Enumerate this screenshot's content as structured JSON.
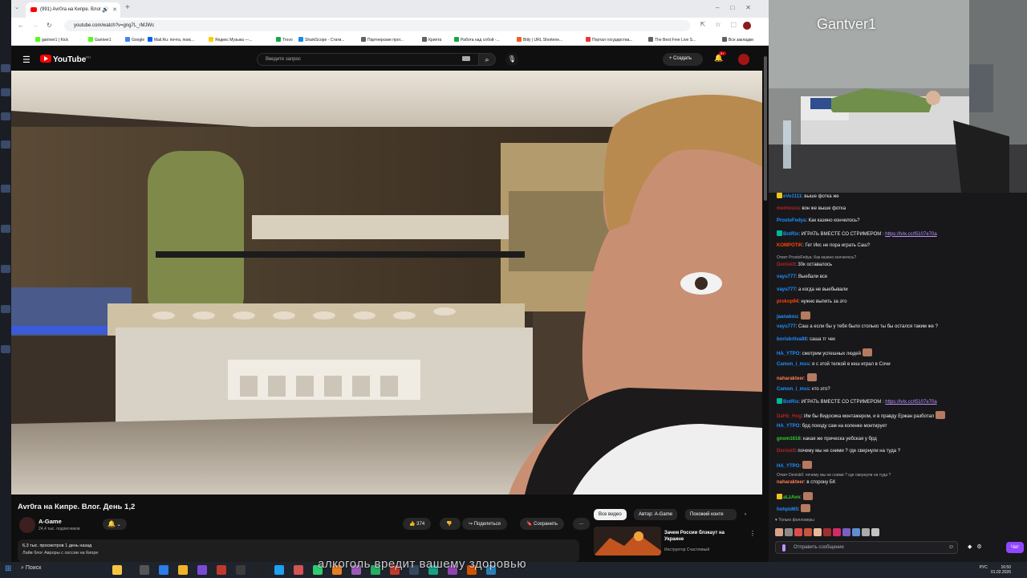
{
  "browser": {
    "tab_title": "(991) Avr0ra на Кипре. Влог",
    "url": "youtube.com/watch?v=gng7L_rMJWc",
    "bookmarks": [
      "gantver1 | Kick",
      "Gantver1",
      "Google",
      "Mail.Ru: почта, поис...",
      "Яндекс Музыка —...",
      "Trovo",
      "SharkScope - Стати...",
      "Партнерские прог...",
      "Крипта",
      "Работа над собой -...",
      "Bitly | URL Shortene...",
      "Портал государства...",
      "The Best Free Live S...",
      "Все закладки"
    ]
  },
  "youtube": {
    "logo": "YouTube",
    "logo_region": "RU",
    "search_placeholder": "Введите запрос",
    "create_label": "Создать",
    "notifications_badge": "9+",
    "video_title": "Avr0ra на Кипре. Влог. День 1,2",
    "channel_name": "A-Game",
    "subscribers": "24,4 тыс. подписчиков",
    "likes": "374",
    "share_label": "Поделиться",
    "save_label": "Сохранить",
    "more_label": "...",
    "description_line1": "6,3 тыс. просмотров  1 день назад",
    "description_line2": "Лайв блог Авроры с сессии на Кипре",
    "chips": [
      "Все видео",
      "Автор: A-Game",
      "Похожий конте"
    ],
    "rec_title": "Зачем России блэкаут на Украине",
    "rec_channel": "Инструктор Счастливый"
  },
  "webcam": {
    "streamer_name": "Gantver1"
  },
  "chat": {
    "messages": [
      {
        "user": "eVo1111",
        "text": ": выше фотка же",
        "color": "#1e90ff",
        "badge": "#f0c419"
      },
      {
        "user": "mentosss",
        "text": ": вон же выше фотка",
        "color": "#b22222",
        "badge": ""
      },
      {
        "user": "ProstoFedya",
        "text": ": Как казино кончилось?",
        "color": "#1e90ff",
        "badge": ""
      },
      {
        "user": "BotRix",
        "text": ": ИГРАТЬ ВМЕСТЕ СО СТРИМЕРОМ : ",
        "link": "https://lvlx.cc/t5107e70a",
        "color": "#1e90ff",
        "badge": "#00b894"
      },
      {
        "user": "KOMPOTiK",
        "text": ": Гет Икс не пора играть Саш?",
        "color": "#ff4500",
        "badge": ""
      },
      {
        "user": "Denisk0",
        "text": ": 30к оставалось",
        "color": "#b22222",
        "badge": "",
        "reply": "Ответ ProstoFedya: Как казино кончилось?"
      },
      {
        "user": "vayu777",
        "text": ": Выебали все",
        "color": "#1e90ff",
        "badge": ""
      },
      {
        "user": "vayu777",
        "text": ": а когда не выебывали",
        "color": "#1e90ff",
        "badge": ""
      },
      {
        "user": "prokop94",
        "text": ": нужно выпить за это",
        "color": "#ff4500",
        "badge": ""
      },
      {
        "user": "jaanakou",
        "text": ":",
        "color": "#1e90ff",
        "badge": "",
        "emote": true
      },
      {
        "user": "vayu777",
        "text": ": Саш а если бы у тебя было столько ты бы остался таким же ?",
        "color": "#1e90ff",
        "badge": ""
      },
      {
        "user": "borisbritva88",
        "text": ": саша тг чек",
        "color": "#1e90ff",
        "badge": ""
      },
      {
        "user": "HA_YTPO",
        "text": ": смотрим успешных людей",
        "color": "#1e90ff",
        "badge": "",
        "emote": true
      },
      {
        "user": "Camon_i_mss",
        "text": ": я с этой телкой в кеш играл в Сочи",
        "color": "#1e90ff",
        "badge": ""
      },
      {
        "user": "naharakteer",
        "text": ":",
        "color": "#ff7f50",
        "badge": "",
        "emote": true
      },
      {
        "user": "Camon_i_mss",
        "text": ": кто это?",
        "color": "#1e90ff",
        "badge": ""
      },
      {
        "user": "BotRix",
        "text": ": ИГРАТЬ ВМЕСТЕ СО СТРИМЕРОМ : ",
        "link": "https://lvlx.cc/t5107e70a",
        "color": "#1e90ff",
        "badge": "#00b894"
      },
      {
        "user": "DaHb_Hog",
        "text": ": Им бы Видосика монтажером, и в правду Ержан разботал",
        "color": "#b22222",
        "badge": "",
        "emote": true
      },
      {
        "user": "HA_YTPO",
        "text": ": брд походу сам на коленке монтирует",
        "color": "#1e90ff",
        "badge": ""
      },
      {
        "user": "gnom1616",
        "text": ": какая же прическа уебская у брд",
        "color": "#32cd32",
        "badge": ""
      },
      {
        "user": "Denisk0",
        "text": ": почему мы не сними ? где свернули на туда ?",
        "color": "#b22222",
        "badge": ""
      },
      {
        "user": "HA_YTPO",
        "text": ":",
        "color": "#1e90ff",
        "badge": "",
        "emote": true
      },
      {
        "user": "naharakteer",
        "text": ": в сторону БК",
        "color": "#ff7f50",
        "badge": "",
        "reply": "Ответ Denisk0: почему мы не сними ? где свернули на туда ?"
      },
      {
        "user": "aLzAvo",
        "text": ":",
        "color": "#32cd32",
        "badge": "#f0c419",
        "emote": true
      },
      {
        "user": "hohpid65",
        "text": ":",
        "color": "#1e90ff",
        "badge": "",
        "emote": true
      }
    ],
    "followers_only": "Только фолловеры",
    "input_placeholder": "Отправить сообщение",
    "chat_button": "Чат"
  },
  "taskbar": {
    "search_label": "Поиск",
    "tray_lang": "РУС",
    "time": "16:50",
    "date": "01.02.2026",
    "caption": "алкоголь вредит вашему здоровью"
  }
}
